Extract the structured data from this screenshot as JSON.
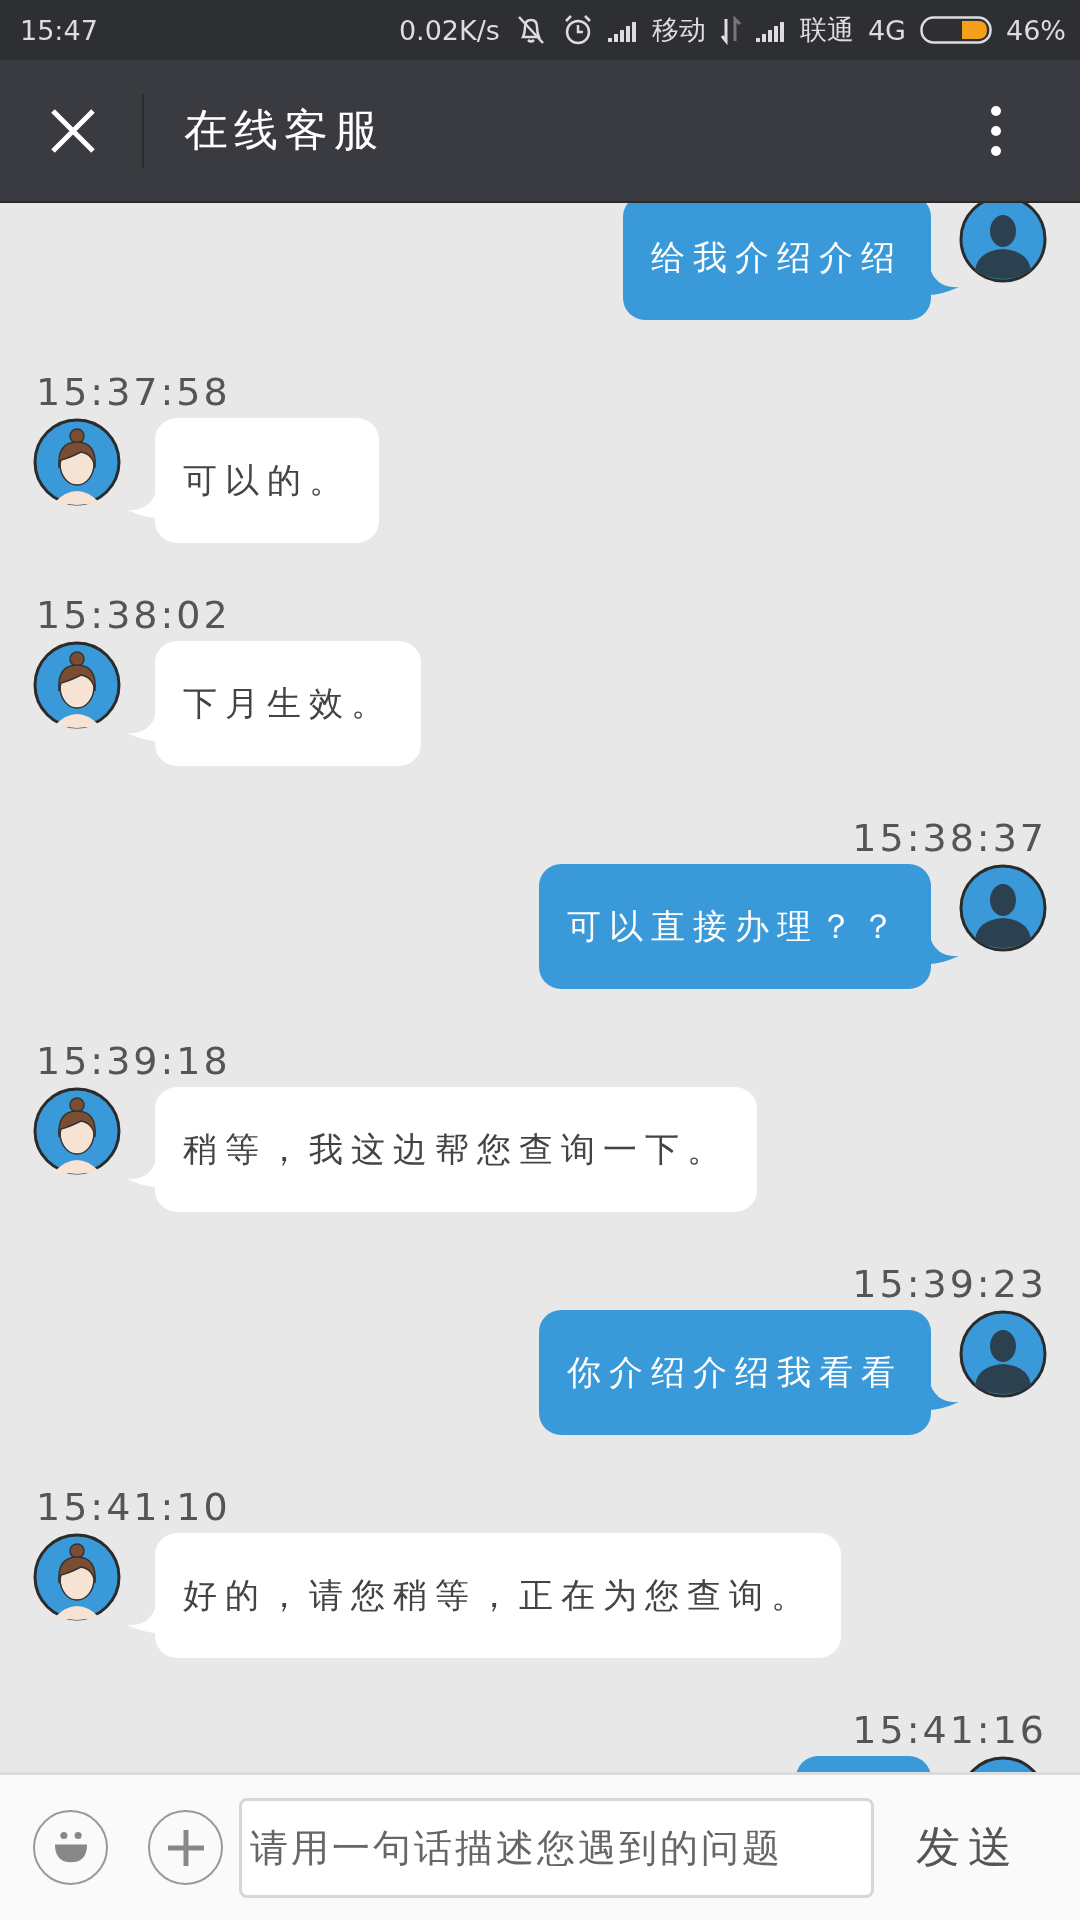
{
  "status_bar": {
    "time": "15:47",
    "net_speed": "0.02K/s",
    "carrier_1": "移动",
    "carrier_2": "联通",
    "network": "4G",
    "battery": "46%"
  },
  "header": {
    "title": "在线客服"
  },
  "messages": [
    {
      "kind": "user",
      "text": "给我介绍介绍"
    },
    {
      "kind": "agent",
      "time": "15:37:58",
      "text": "可以的。"
    },
    {
      "kind": "agent",
      "time": "15:38:02",
      "text": "下月生效。"
    },
    {
      "kind": "user",
      "time": "15:38:37",
      "text": "可以直接办理？？"
    },
    {
      "kind": "agent",
      "time": "15:39:18",
      "text": "稍等，我这边帮您查询一下。"
    },
    {
      "kind": "user",
      "time": "15:39:23",
      "text": "你介绍介绍我看看"
    },
    {
      "kind": "agent",
      "time": "15:41:10",
      "text": "好的，请您稍等，正在为您查询。"
    },
    {
      "kind": "user",
      "time": "15:41:16"
    }
  ],
  "composer": {
    "placeholder": "请用一句话描述您遇到的问题",
    "send": "发送"
  }
}
